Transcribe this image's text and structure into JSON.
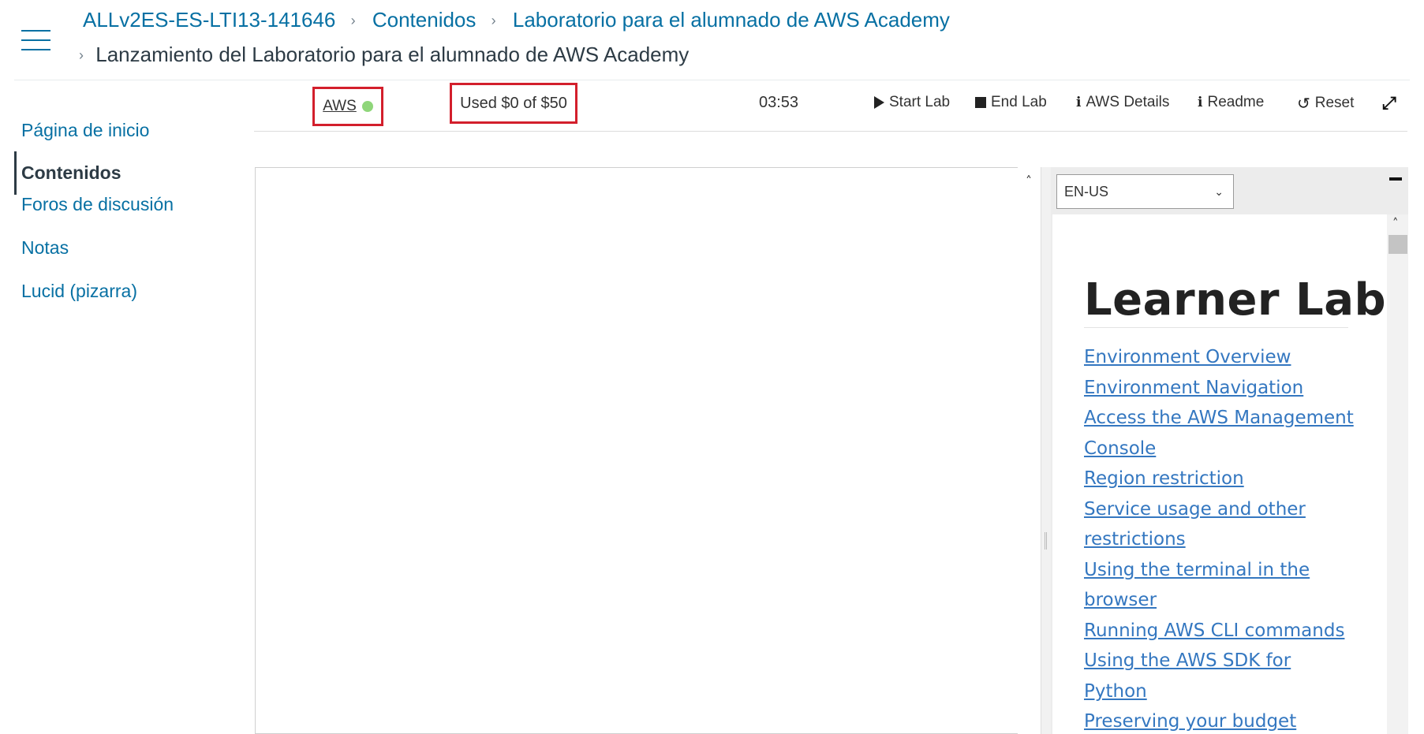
{
  "breadcrumb": {
    "items": [
      "ALLv2ES-ES-LTI13-141646",
      "Contenidos",
      "Laboratorio para el alumnado de AWS Academy"
    ],
    "current": "Lanzamiento del Laboratorio para el alumnado de AWS Academy"
  },
  "sidebar": {
    "items": [
      {
        "label": "Página de inicio"
      },
      {
        "label": "Contenidos"
      },
      {
        "label": "Foros de discusión"
      },
      {
        "label": "Notas"
      },
      {
        "label": "Lucid (pizarra)"
      }
    ]
  },
  "toolbar": {
    "aws_label": "AWS",
    "aws_status_color": "#8fd67a",
    "budget": "Used $0 of $50",
    "timer": "03:53",
    "start_lab": "Start Lab",
    "end_lab": "End Lab",
    "aws_details": "AWS Details",
    "readme": "Readme",
    "reset": "Reset"
  },
  "readme": {
    "language": "EN-US",
    "title": "Learner Lab",
    "toc": [
      "Environment Overview",
      "Environment Navigation",
      "Access the AWS Management",
      "Console",
      "Region restriction",
      "Service usage and other",
      "restrictions",
      "Using the terminal in the",
      "browser",
      "Running AWS CLI commands",
      "Using the AWS SDK for",
      "Python",
      "Preserving your budget"
    ]
  },
  "colors": {
    "link": "#0770a3",
    "highlight_border": "#d31f2c",
    "readme_link": "#3477c0"
  }
}
